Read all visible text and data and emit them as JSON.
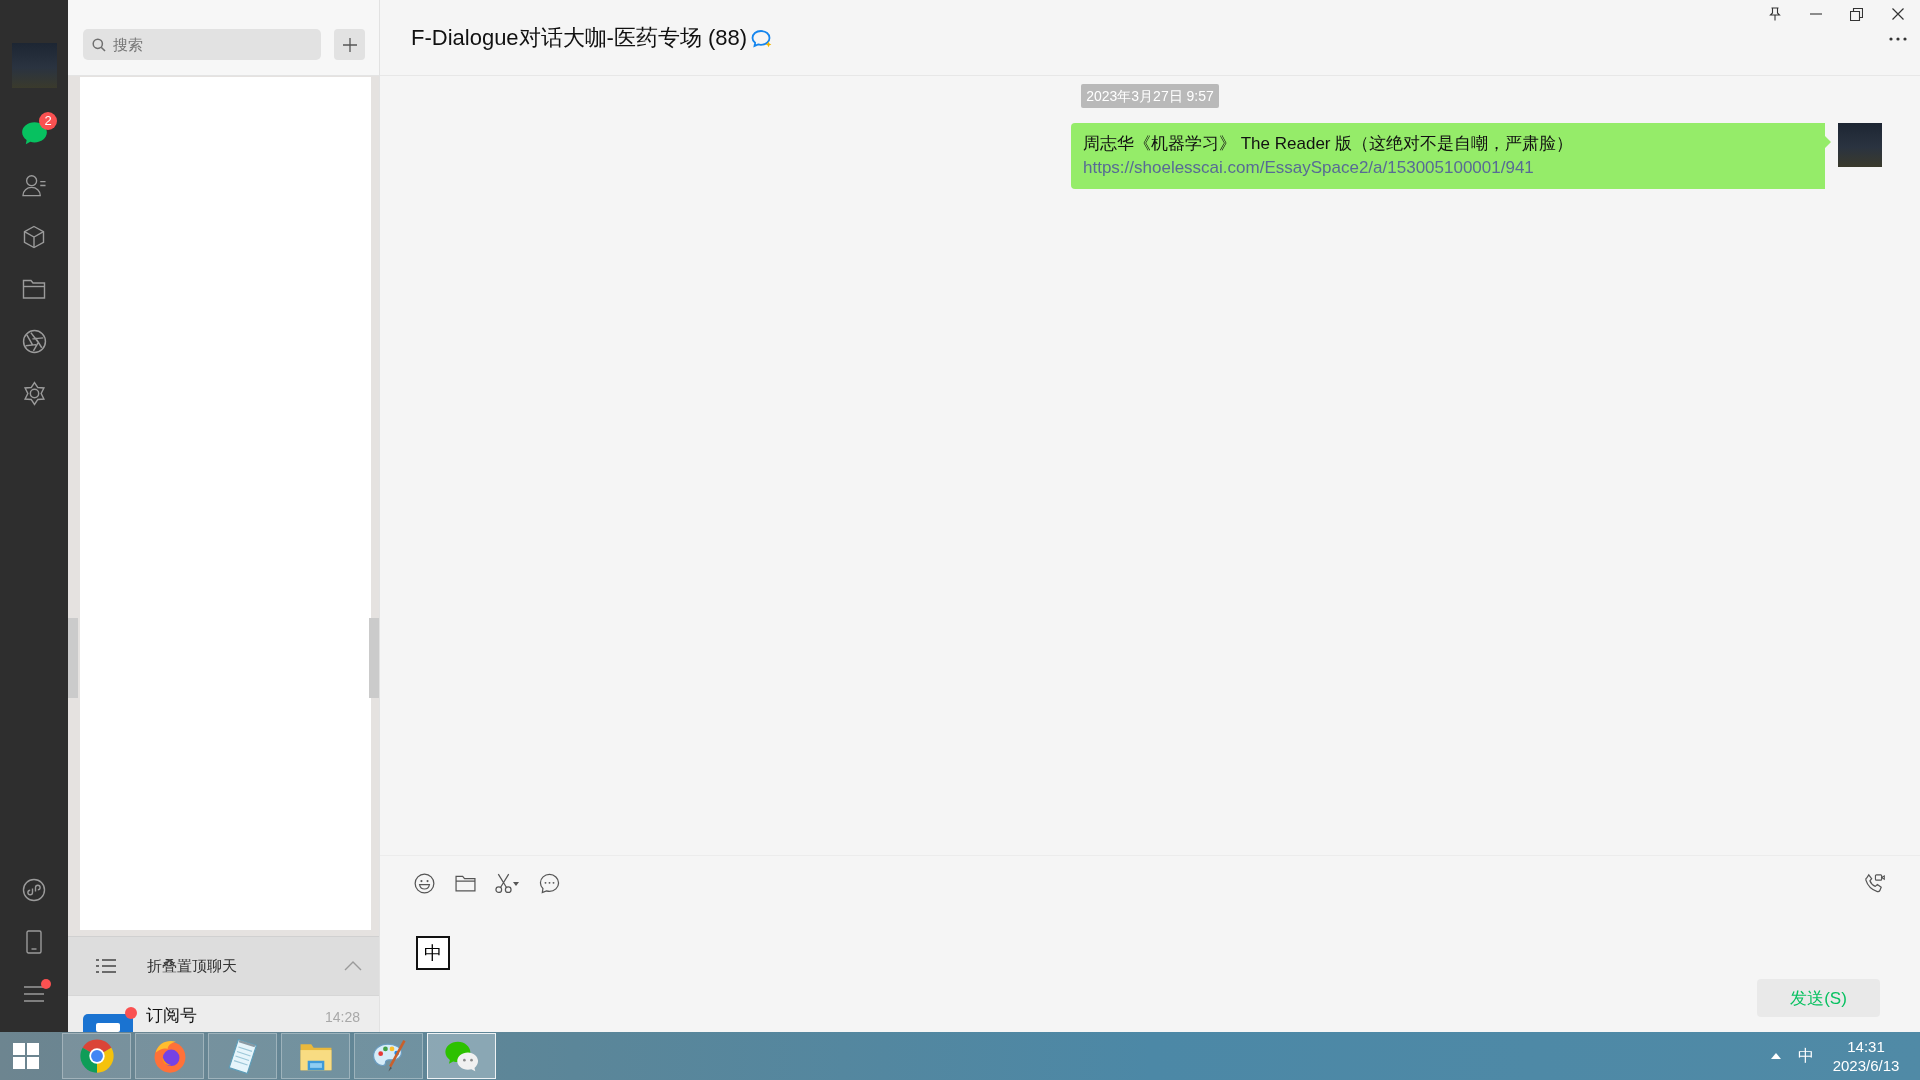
{
  "nav": {
    "items": [
      {
        "kind": "chats",
        "selected": true,
        "badge": "2"
      },
      {
        "kind": "contacts",
        "selected": false
      },
      {
        "kind": "favorites",
        "selected": false
      },
      {
        "kind": "files",
        "selected": false
      },
      {
        "kind": "moments",
        "selected": false
      },
      {
        "kind": "channels",
        "selected": false
      }
    ],
    "bottom_items": [
      {
        "kind": "mini_programs",
        "dot": false
      },
      {
        "kind": "phone",
        "dot": false
      },
      {
        "kind": "menu",
        "dot": true
      }
    ]
  },
  "search": {
    "placeholder": "搜索"
  },
  "pinned_fold": {
    "label": "折叠置顶聊天"
  },
  "chat_list": [
    {
      "name": "订阅号",
      "time": "14:28",
      "unread_dot": true
    }
  ],
  "chat": {
    "title": "F-Dialogue对话大咖-医药专场 (88)",
    "messages": [
      {
        "kind": "timestamp",
        "text": "2023年3月27日 9:57"
      },
      {
        "kind": "text",
        "outgoing": true,
        "text": "周志华《机器学习》 The Reader 版（这绝对不是自嘲，严肃脸）",
        "link": "https://shoelesscai.com/EssaySpace2/a/153005100001/941"
      }
    ]
  },
  "composer": {
    "ime_indicator": "中",
    "send_label": "发送(S)"
  },
  "taskbar": {
    "apps": [
      {
        "kind": "chrome",
        "selected": false
      },
      {
        "kind": "firefox",
        "selected": false
      },
      {
        "kind": "notepad",
        "selected": false
      },
      {
        "kind": "explorer",
        "selected": false
      },
      {
        "kind": "paint",
        "selected": false
      },
      {
        "kind": "wechat",
        "selected": true
      }
    ],
    "tray": {
      "ime": "中",
      "time": "14:31",
      "date": "2023/6/13"
    }
  }
}
